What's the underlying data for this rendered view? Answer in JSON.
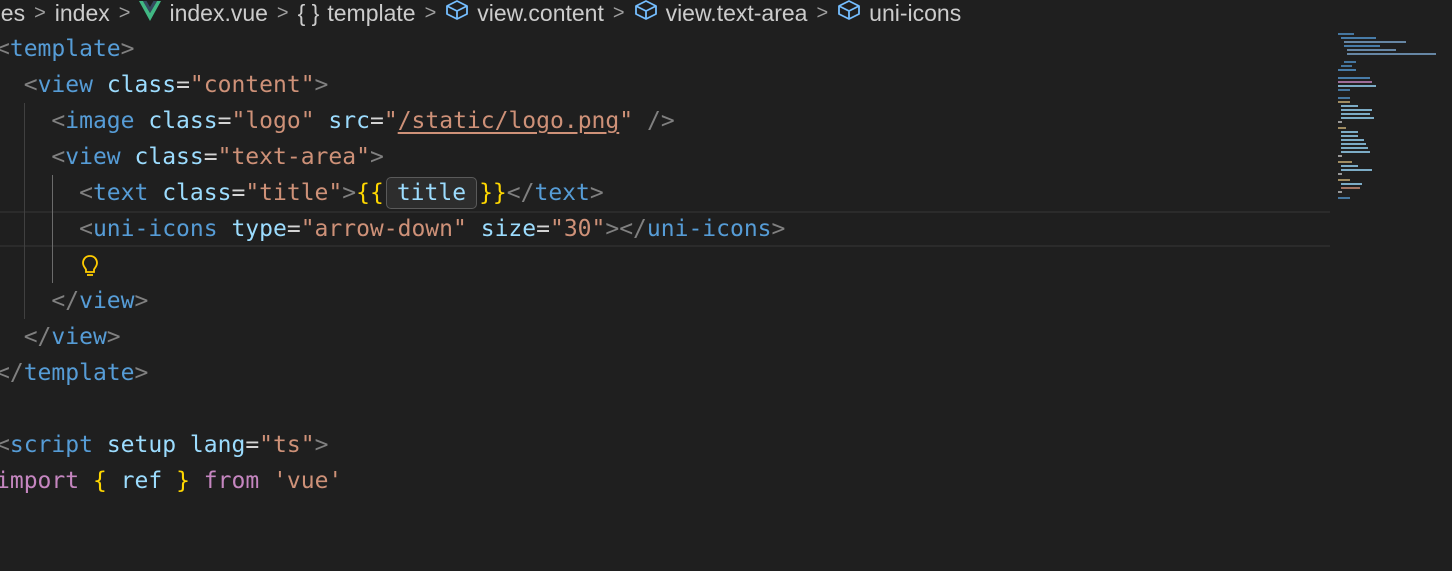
{
  "breadcrumb": {
    "items": [
      {
        "label": "ges",
        "icon": null
      },
      {
        "label": "index",
        "icon": null
      },
      {
        "label": "index.vue",
        "icon": "vue-icon"
      },
      {
        "label": "template",
        "icon": "braces-icon"
      },
      {
        "label": "view.content",
        "icon": "cube-icon"
      },
      {
        "label": "view.text-area",
        "icon": "cube-icon"
      },
      {
        "label": "uni-icons",
        "icon": "cube-icon"
      }
    ],
    "braces_glyph": "{ }"
  },
  "code": {
    "l1_tag": "template",
    "l2_tag": "view",
    "l2_attr": "class",
    "l2_val": "\"content\"",
    "l3_tag": "image",
    "l3_attr1": "class",
    "l3_val1": "\"logo\"",
    "l3_attr2": "src",
    "l3_val2_open": "\"",
    "l3_val2_path": "/static/logo.png",
    "l3_val2_close": "\"",
    "l4_tag": "view",
    "l4_attr": "class",
    "l4_val": "\"text-area\"",
    "l5_tag": "text",
    "l5_attr": "class",
    "l5_val": "\"title\"",
    "l5_open": "{{",
    "l5_expr": "title",
    "l5_close": "}}",
    "l6_tag": "uni-icons",
    "l6_attr1": "type",
    "l6_val1": "\"arrow-down\"",
    "l6_attr2": "size",
    "l6_val2": "\"30\"",
    "l8_tag": "view",
    "l9_tag": "view",
    "l10_tag": "template",
    "l12_tag": "script",
    "l12_attr1": "setup",
    "l12_attr2": "lang",
    "l12_val": "\"ts\"",
    "l13_kw1": "import",
    "l13_open": "{",
    "l13_name": "ref",
    "l13_close": "}",
    "l13_kw2": "from",
    "l13_str": "'vue'"
  },
  "colors": {
    "background": "#1f1f1f",
    "tag": "#569cd6",
    "attribute": "#9cdcfe",
    "string": "#ce9178",
    "brace": "#ffd700",
    "keyword": "#c586c0",
    "vue_green": "#41b883",
    "lightbulb": "#ffcc00"
  }
}
